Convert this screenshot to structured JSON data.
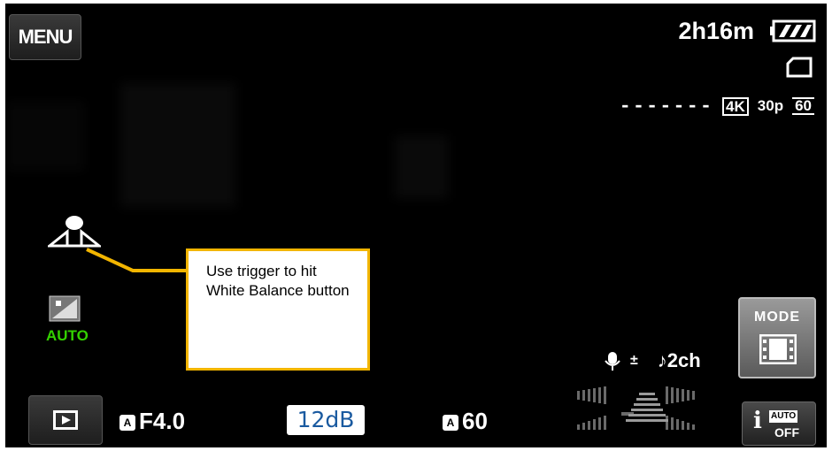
{
  "menu": {
    "label": "MENU"
  },
  "status": {
    "remaining_time": "2h16m",
    "battery_icon": "battery-full-icon",
    "card_icon": "memory-card-icon"
  },
  "recording": {
    "dashes": "-------",
    "resolution": "4K",
    "frame_rate": "30p",
    "shutter_mode": "60"
  },
  "left_panel": {
    "white_balance_icon": "white-balance-icon",
    "scene_icon": "scene-mode-icon",
    "scene_label": "AUTO"
  },
  "callout": {
    "text": "Use trigger to hit White Balance button"
  },
  "mode_button": {
    "label": "MODE",
    "icon": "film-icon"
  },
  "audio": {
    "mic_adjust": "±",
    "channels": "2ch",
    "mic_icon": "microphone-icon",
    "note_icon": "music-note-icon"
  },
  "bottom_bar": {
    "aperture": "F4.0",
    "aperture_badge": "A",
    "gain": "12dB",
    "shutter": "60",
    "shutter_badge": "A"
  },
  "ia_button": {
    "i": "i",
    "auto": "AUTO",
    "off": "OFF"
  },
  "colors": {
    "callout_border": "#f2b500",
    "scene_auto": "#33d000",
    "gain_text": "#1a5aa0"
  }
}
